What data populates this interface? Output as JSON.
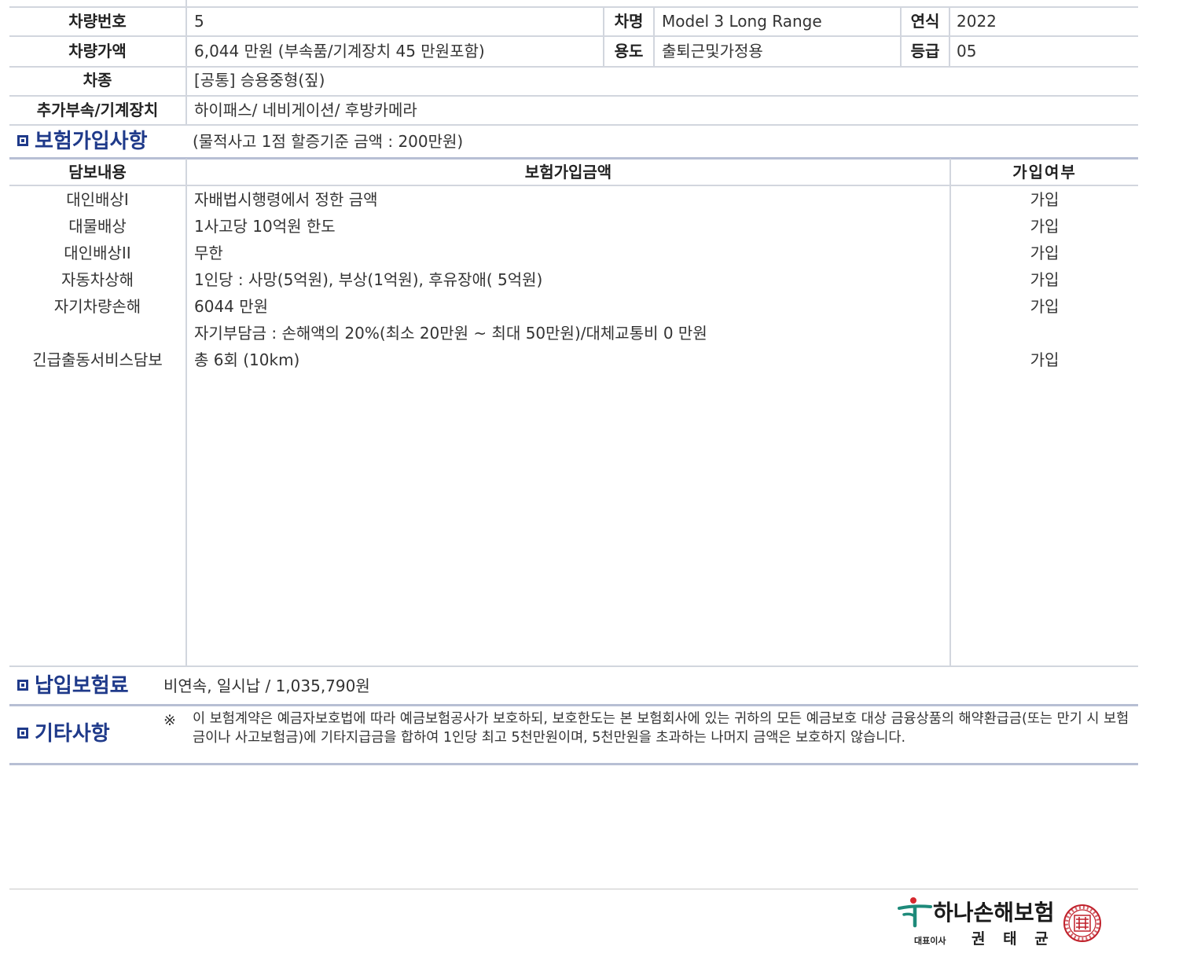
{
  "vehicle": {
    "plate_label": "차량번호",
    "plate_value": "5",
    "model_label": "차명",
    "model_value": "Model 3 Long Range",
    "year_label": "연식",
    "year_value": "2022",
    "price_label": "차량가액",
    "price_value": "6,044 만원 (부속품/기계장치 45 만원포함)",
    "use_label": "용도",
    "use_value": "출퇴근및가정용",
    "grade_label": "등급",
    "grade_value": "05",
    "type_label": "차종",
    "type_value": "[공통] 승용중형(짚)",
    "accessory_label": "추가부속/기계장치",
    "accessory_value": "하이패스/ 네비게이션/ 후방카메라"
  },
  "coverage": {
    "section_title": "보험가입사항",
    "section_note": "(물적사고 1점 할증기준 금액 : 200만원)",
    "headers": [
      "담보내용",
      "보험가입금액",
      "가입여부"
    ],
    "rows": [
      {
        "name": "대인배상I",
        "amount": "자배법시행령에서 정한 금액",
        "status": "가입"
      },
      {
        "name": "대물배상",
        "amount": "1사고당 10억원 한도",
        "status": "가입"
      },
      {
        "name": "대인배상II",
        "amount": "무한",
        "status": "가입"
      },
      {
        "name": "자동차상해",
        "amount": "1인당 : 사망(5억원), 부상(1억원), 후유장애( 5억원)",
        "status": "가입"
      },
      {
        "name": "자기차량손해",
        "amount": "6044 만원",
        "status": "가입"
      },
      {
        "name": "",
        "amount": "자기부담금 : 손해액의 20%(최소 20만원 ~ 최대 50만원)/대체교통비 0 만원",
        "status": ""
      },
      {
        "name": "긴급출동서비스담보",
        "amount": "총 6회 (10km)",
        "status": "가입"
      }
    ]
  },
  "premium": {
    "title": "납입보험료",
    "value": "비연속, 일시납 / 1,035,790원"
  },
  "other": {
    "title": "기타사항",
    "mark": "※",
    "text": "이 보험계약은 예금자보호법에 따라 예금보험공사가 보호하되, 보호한도는 본 보험회사에 있는 귀하의 모든 예금보호 대상 금융상품의 해약환급금(또는 만기 시 보험금이나 사고보험금)에 기타지급금을 합하여 1인당 최고 5천만원이며, 5천만원을 초과하는 나머지 금액은 보호하지 않습니다."
  },
  "footer": {
    "company": "하나손해보험",
    "ceo_label": "대표이사",
    "ceo_name": "권 태 균",
    "brand_color": "#1e8a7a",
    "seal_color": "#c0212b"
  }
}
